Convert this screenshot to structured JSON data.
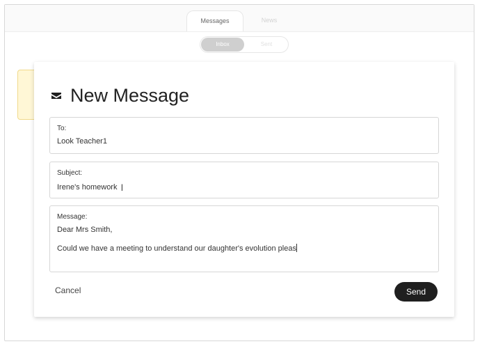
{
  "tabs": [
    {
      "label": "Messages",
      "active": true
    },
    {
      "label": "News",
      "active": false
    }
  ],
  "folders": [
    {
      "label": "Inbox",
      "active": true
    },
    {
      "label": "Sent",
      "active": false
    }
  ],
  "modal": {
    "icon": "envelope-icon",
    "title": "New Message",
    "to": {
      "label": "To:",
      "value": "Look Teacher1"
    },
    "subject": {
      "label": "Subject:",
      "value": "Irene's homework"
    },
    "message": {
      "label": "Message:",
      "line1": "Dear Mrs Smith,",
      "line2": "Could we have a meeting to understand our daughter's evolution pleas"
    },
    "cancel_label": "Cancel",
    "send_label": "Send"
  },
  "colors": {
    "notice_bg": "#fff7d6",
    "send_bg": "#1f1f1f",
    "inbox_active_bg": "#cfcfcf"
  }
}
